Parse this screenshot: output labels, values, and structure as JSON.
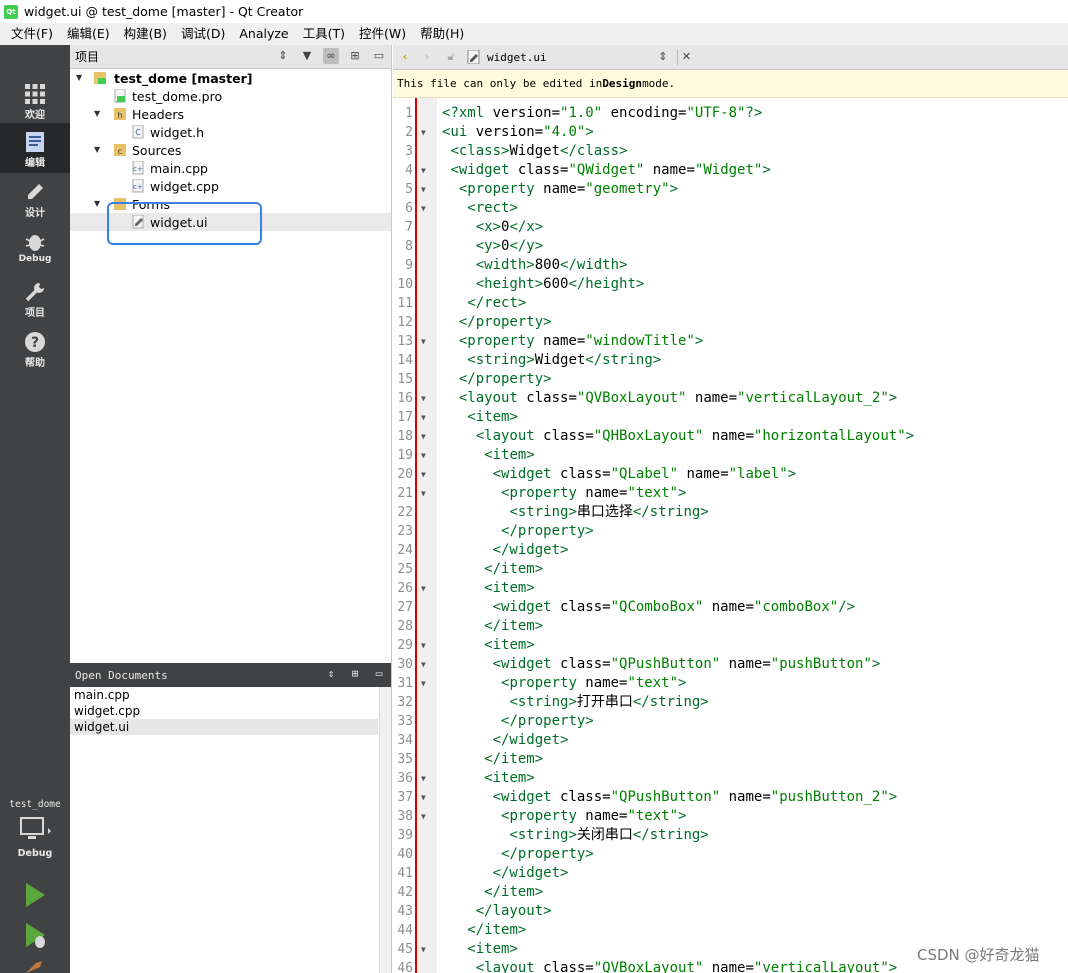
{
  "window": {
    "title": "widget.ui @ test_dome [master] - Qt Creator",
    "app_icon_label": "Qt"
  },
  "menu": [
    "文件(F)",
    "编辑(E)",
    "构建(B)",
    "调试(D)",
    "Analyze",
    "工具(T)",
    "控件(W)",
    "帮助(H)"
  ],
  "modes": [
    {
      "label": "欢迎",
      "icon": "grid-icon"
    },
    {
      "label": "编辑",
      "icon": "edit-icon"
    },
    {
      "label": "设计",
      "icon": "pencil-icon"
    },
    {
      "label": "Debug",
      "icon": "bug-icon"
    },
    {
      "label": "项目",
      "icon": "wrench-icon"
    },
    {
      "label": "帮助",
      "icon": "help-icon"
    }
  ],
  "kit": {
    "name": "test_dome",
    "mode": "Debug"
  },
  "projects": {
    "header": "项目",
    "root": "test_dome [master]",
    "pro_file": "test_dome.pro",
    "headers_label": "Headers",
    "header_file": "widget.h",
    "sources_label": "Sources",
    "source_files": [
      "main.cpp",
      "widget.cpp"
    ],
    "forms_label": "Forms",
    "form_file": "widget.ui"
  },
  "open_documents": {
    "header": "Open Documents",
    "items": [
      "main.cpp",
      "widget.cpp",
      "widget.ui"
    ],
    "selected": "widget.ui"
  },
  "editor": {
    "filename": "widget.ui",
    "info_prefix": "This file can only be edited in ",
    "info_bold": "Design",
    "info_suffix": " mode."
  },
  "colors": {
    "accent_highlight": "#3d7fe8",
    "mode_bar": "#404244",
    "info_bar": "#fffbdc",
    "margin_line": "#d90000"
  },
  "watermark": "CSDN @好奇龙猫"
}
